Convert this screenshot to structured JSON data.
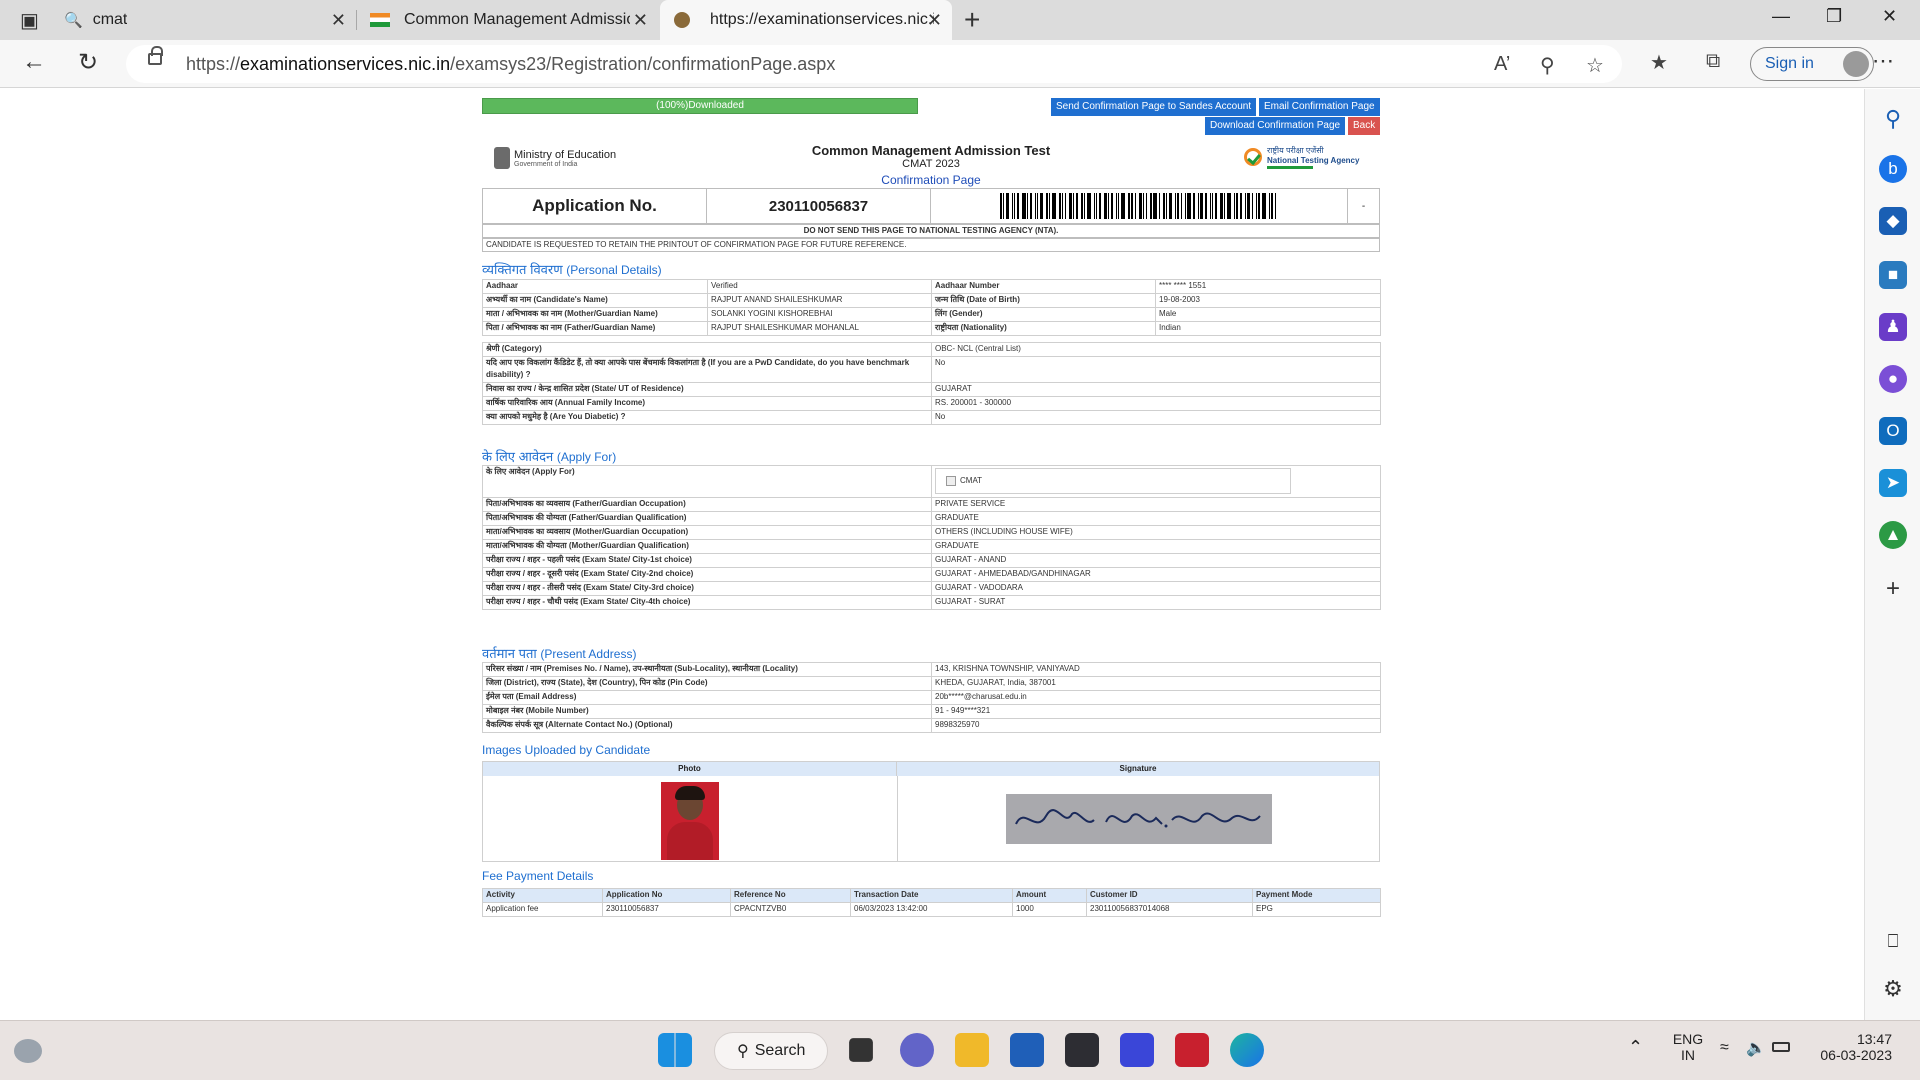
{
  "browser": {
    "tabs": [
      {
        "title": "cmat",
        "icon": "search-icon"
      },
      {
        "title": "Common Management Admissio",
        "icon": "india-flag-icon"
      },
      {
        "title": "https://examinationservices.nic.in",
        "icon": "site-emblem-icon"
      }
    ],
    "url_prefix": "https://",
    "url_domain": "examinationservices.nic.in",
    "url_path": "/examsys23/Registration/confirmationPage.aspx",
    "signin_label": "Sign in"
  },
  "toolbar": {
    "progress_label": "(100%)Downloaded",
    "send_sandes_label": "Send Confirmation Page to Sandes Account",
    "email_label": "Email Confirmation Page",
    "download_label": "Download Confirmation Page",
    "back_label": "Back"
  },
  "header": {
    "ministry": "Ministry of Education",
    "ministry_sub": "Government of India",
    "title": "Common Management Admission Test",
    "subtitle": "CMAT 2023",
    "page_name": "Confirmation Page",
    "agency_hindi": "राष्ट्रीय परीक्षा एजेंसी",
    "agency": "National Testing Agency"
  },
  "application": {
    "label": "Application No.",
    "number": "230110056837",
    "extra": "-",
    "notice1": "DO NOT SEND THIS PAGE TO NATIONAL TESTING AGENCY (NTA).",
    "notice2": "CANDIDATE IS REQUESTED TO RETAIN THE PRINTOUT OF CONFIRMATION PAGE FOR FUTURE REFERENCE."
  },
  "personal": {
    "title_hi": "व्यक्तिगत विवरण",
    "title_en": "(Personal Details)",
    "rows": [
      [
        "Aadhaar",
        "Verified",
        "Aadhaar Number",
        "**** **** 1551"
      ],
      [
        "अभ्यर्थी का नाम (Candidate's Name)",
        "RAJPUT ANAND SHAILESHKUMAR",
        "जन्म तिथि (Date of Birth)",
        "19-08-2003"
      ],
      [
        "माता / अभिभावक का नाम (Mother/Guardian Name)",
        "SOLANKI YOGINI KISHOREBHAI",
        "लिंग (Gender)",
        "Male"
      ],
      [
        "पिता / अभिभावक का नाम (Father/Guardian Name)",
        "RAJPUT SHAILESHKUMAR MOHANLAL",
        "राष्ट्रीयता (Nationality)",
        "Indian"
      ]
    ],
    "extra_rows": [
      [
        "श्रेणी (Category)",
        "OBC- NCL (Central List)"
      ],
      [
        "यदि आप एक विकलांग कैंडिडेट हैं, तो क्या आपके पास बेंचमार्क विकलांगता है (If you are a PwD Candidate, do you have benchmark disability) ?",
        "No"
      ],
      [
        "निवास का राज्य / केन्द्र शासित प्रदेश (State/ UT of Residence)",
        "GUJARAT"
      ],
      [
        "वार्षिक पारिवारिक आय (Annual Family Income)",
        "RS. 200001 - 300000"
      ],
      [
        "क्या आपको मधुमेह है (Are You Diabetic) ?",
        "No"
      ]
    ]
  },
  "apply": {
    "title_hi": "के लिए आवेदन",
    "title_en": "(Apply For)",
    "apply_label": "के लिए आवेदन (Apply For)",
    "apply_value": "CMAT",
    "rows": [
      [
        "पिता/अभिभावक का व्यवसाय (Father/Guardian Occupation)",
        "PRIVATE SERVICE"
      ],
      [
        "पिता/अभिभावक की योग्यता (Father/Guardian Qualification)",
        "GRADUATE"
      ],
      [
        "माता/अभिभावक का व्यवसाय (Mother/Guardian Occupation)",
        "OTHERS (INCLUDING HOUSE WIFE)"
      ],
      [
        "माता/अभिभावक की योग्यता (Mother/Guardian Qualification)",
        "GRADUATE"
      ],
      [
        "परीक्षा राज्य / शहर - पहली पसंद (Exam State/ City-1st choice)",
        "GUJARAT - ANAND"
      ],
      [
        "परीक्षा राज्य / शहर - दूसरी पसंद (Exam State/ City-2nd choice)",
        "GUJARAT - AHMEDABAD/GANDHINAGAR"
      ],
      [
        "परीक्षा राज्य / शहर - तीसरी पसंद (Exam State/ City-3rd choice)",
        "GUJARAT - VADODARA"
      ],
      [
        "परीक्षा राज्य / शहर - चौथी पसंद (Exam State/ City-4th choice)",
        "GUJARAT - SURAT"
      ]
    ]
  },
  "address": {
    "title_hi": "वर्तमान पता",
    "title_en": "(Present Address)",
    "rows": [
      [
        "परिसर संख्या / नाम (Premises No. / Name), उप-स्थानीयता (Sub-Locality), स्थानीयता (Locality)",
        "143, KRISHNA TOWNSHIP, VANIYAVAD"
      ],
      [
        "जिला (District), राज्य (State), देश (Country), पिन कोड (Pin Code)",
        "KHEDA, GUJARAT, India, 387001"
      ],
      [
        "ईमेल पता (Email Address)",
        "20b*****@charusat.edu.in"
      ],
      [
        "मोबाइल नंबर (Mobile Number)",
        "91 - 949****321"
      ],
      [
        "वैकल्पिक संपर्क सूत्र (Alternate Contact No.) (Optional)",
        "9898325970"
      ]
    ]
  },
  "images": {
    "title": "Images Uploaded by Candidate",
    "photo_label": "Photo",
    "signature_label": "Signature"
  },
  "fee": {
    "title": "Fee Payment Details",
    "headers": [
      "Activity",
      "Application No",
      "Reference No",
      "Transaction Date",
      "Amount",
      "Customer ID",
      "Payment Mode"
    ],
    "row": [
      "Application fee",
      "230110056837",
      "CPACNTZVB0",
      "06/03/2023 13:42:00",
      "1000",
      "230110056837014068",
      "EPG"
    ]
  },
  "taskbar": {
    "search_label": "Search",
    "lang1": "ENG",
    "lang2": "IN",
    "time": "13:47",
    "date": "06-03-2023"
  }
}
